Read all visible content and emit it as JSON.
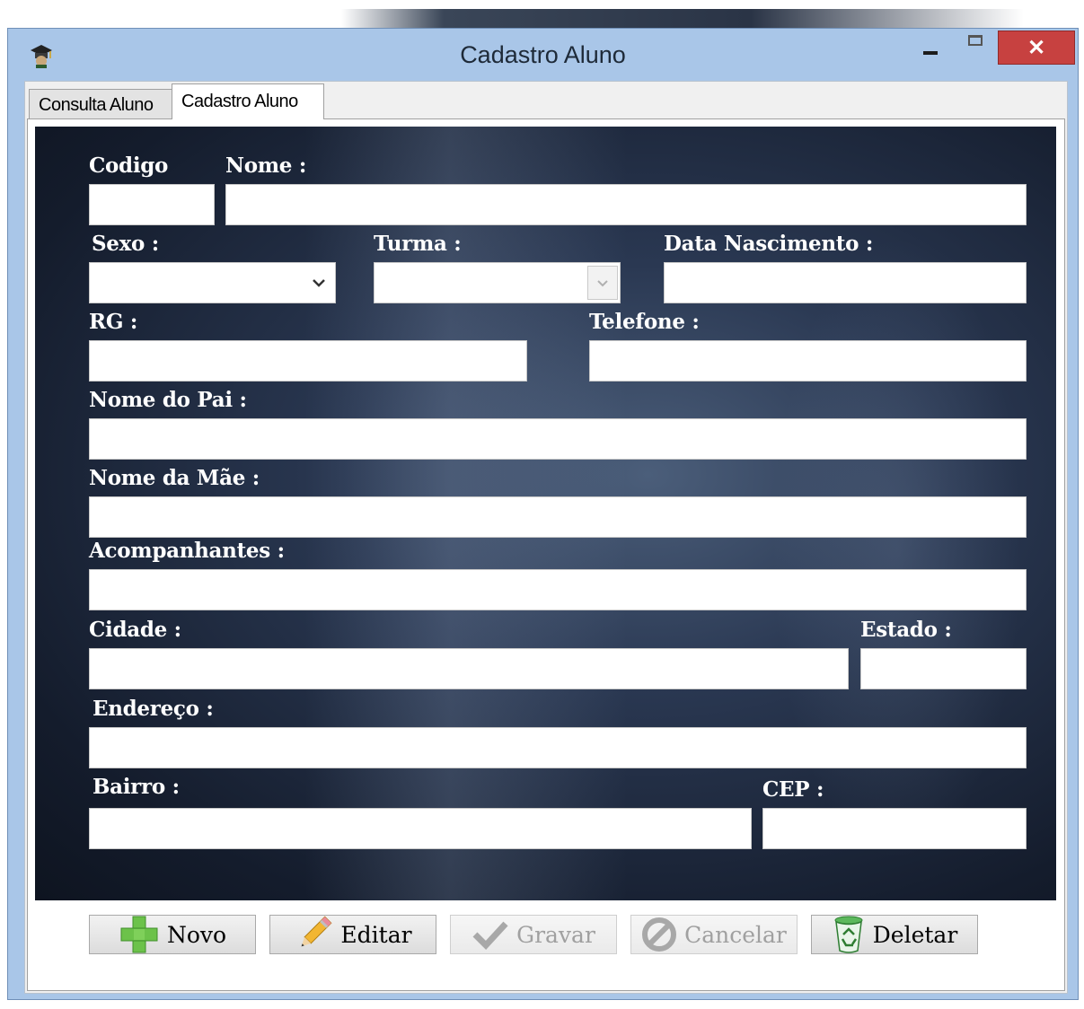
{
  "window": {
    "title": "Cadastro Aluno",
    "icon": "graduation-cap-icon",
    "close_symbol": "✕"
  },
  "tabs": [
    {
      "label": "Consulta Aluno",
      "active": false
    },
    {
      "label": "Cadastro Aluno",
      "active": true
    }
  ],
  "form": {
    "codigo": {
      "label": "Codigo",
      "value": ""
    },
    "nome": {
      "label": "Nome :",
      "value": ""
    },
    "sexo": {
      "label": "Sexo :",
      "selected": ""
    },
    "turma": {
      "label": "Turma :",
      "selected": "",
      "enabled": false
    },
    "data_nascimento": {
      "label": "Data Nascimento :",
      "value": ""
    },
    "rg": {
      "label": "RG :",
      "value": ""
    },
    "telefone": {
      "label": "Telefone :",
      "value": ""
    },
    "nome_pai": {
      "label": "Nome do Pai :",
      "value": ""
    },
    "nome_mae": {
      "label": "Nome da Mãe :",
      "value": ""
    },
    "acompanhantes": {
      "label": "Acompanhantes :",
      "value": ""
    },
    "cidade": {
      "label": "Cidade :",
      "value": ""
    },
    "estado": {
      "label": "Estado :",
      "value": ""
    },
    "endereco": {
      "label": "Endereço :",
      "value": ""
    },
    "bairro": {
      "label": "Bairro :",
      "value": ""
    },
    "cep": {
      "label": "CEP :",
      "value": ""
    }
  },
  "buttons": {
    "novo": {
      "label": "Novo",
      "icon": "plus-icon",
      "color": "#6cc24a",
      "enabled": true
    },
    "editar": {
      "label": "Editar",
      "icon": "pencil-icon",
      "enabled": true
    },
    "gravar": {
      "label": "Gravar",
      "icon": "checkmark-icon",
      "enabled": false
    },
    "cancelar": {
      "label": "Cancelar",
      "icon": "cancel-icon",
      "enabled": false
    },
    "deletar": {
      "label": "Deletar",
      "icon": "recycle-bin-icon",
      "color": "#4caf50",
      "enabled": true
    }
  },
  "colors": {
    "title_bar": "#a9c6e8",
    "close_button": "#c74140",
    "form_background": "#1e2a40"
  }
}
